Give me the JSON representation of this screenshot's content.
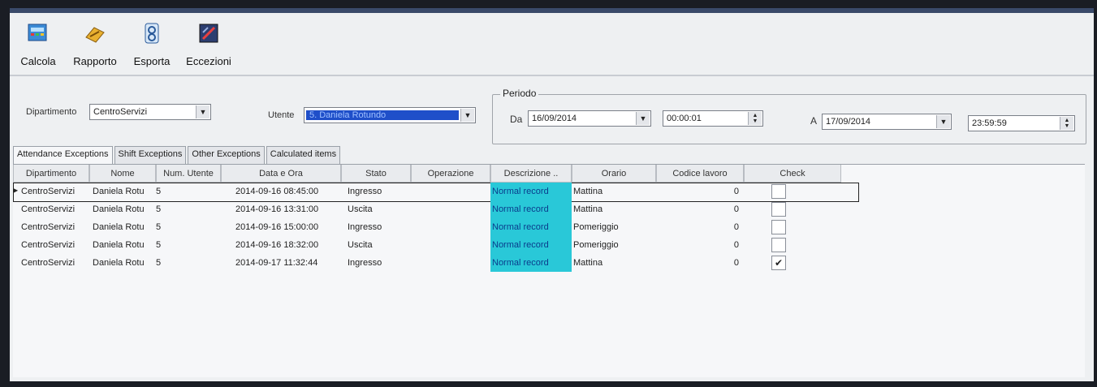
{
  "toolbar": {
    "buttons": [
      {
        "label": "Calcola"
      },
      {
        "label": "Rapporto"
      },
      {
        "label": "Esporta"
      },
      {
        "label": "Eccezioni"
      }
    ]
  },
  "filters": {
    "dipartimento_label": "Dipartimento",
    "dipartimento_value": "CentroServizi",
    "utente_label": "Utente",
    "utente_value": "5. Daniela Rotundo",
    "periodo_label": "Periodo",
    "da_label": "Da",
    "da_date": "16/09/2014",
    "da_time": "00:00:01",
    "a_label": "A",
    "a_date": "17/09/2014",
    "a_time": "23:59:59"
  },
  "tabs": [
    {
      "label": "Attendance Exceptions",
      "active": true
    },
    {
      "label": "Shift Exceptions",
      "active": false
    },
    {
      "label": "Other Exceptions",
      "active": false
    },
    {
      "label": "Calculated items",
      "active": false
    }
  ],
  "grid": {
    "columns": [
      "Dipartimento",
      "Nome",
      "Num. Utente",
      "Data e Ora",
      "Stato",
      "Operazione",
      "Descrizione ..",
      "Orario",
      "Codice lavoro",
      "Check"
    ],
    "rows": [
      {
        "dip": "CentroServizi",
        "nome": "Daniela Rotu",
        "num": "5",
        "data": "2014-09-16 08:45:00",
        "stato": "Ingresso",
        "oper": "",
        "desc": "Normal record",
        "orario": "Mattina",
        "codice": "0",
        "check": false
      },
      {
        "dip": "CentroServizi",
        "nome": "Daniela Rotu",
        "num": "5",
        "data": "2014-09-16 13:31:00",
        "stato": "Uscita",
        "oper": "",
        "desc": "Normal record",
        "orario": "Mattina",
        "codice": "0",
        "check": false
      },
      {
        "dip": "CentroServizi",
        "nome": "Daniela Rotu",
        "num": "5",
        "data": "2014-09-16 15:00:00",
        "stato": "Ingresso",
        "oper": "",
        "desc": "Normal record",
        "orario": "Pomeriggio",
        "codice": "0",
        "check": false
      },
      {
        "dip": "CentroServizi",
        "nome": "Daniela Rotu",
        "num": "5",
        "data": "2014-09-16 18:32:00",
        "stato": "Uscita",
        "oper": "",
        "desc": "Normal record",
        "orario": "Pomeriggio",
        "codice": "0",
        "check": false
      },
      {
        "dip": "CentroServizi",
        "nome": "Daniela Rotu",
        "num": "5",
        "data": "2014-09-17 11:32:44",
        "stato": "Ingresso",
        "oper": "",
        "desc": "Normal record",
        "orario": "Mattina",
        "codice": "0",
        "check": true
      }
    ]
  },
  "icons": {
    "calcola": "calculator-icon",
    "rapporto": "report-icon",
    "esporta": "export-icon",
    "eccezioni": "exceptions-icon"
  },
  "colors": {
    "selection": "#1f4fc9",
    "desc_highlight": "#29c8d8"
  }
}
